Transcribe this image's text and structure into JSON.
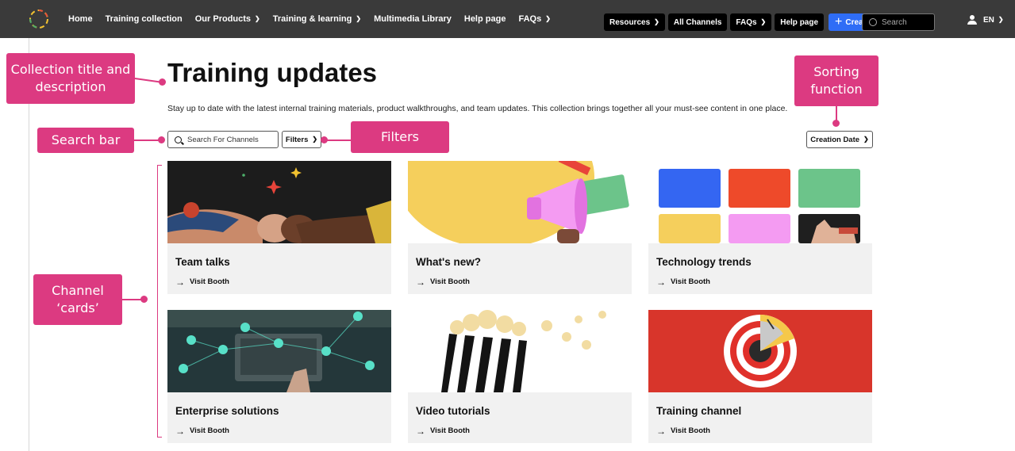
{
  "nav": {
    "left_items": [
      {
        "label": "Home",
        "dropdown": false
      },
      {
        "label": "Training collection",
        "dropdown": false
      },
      {
        "label": "Our Products",
        "dropdown": true
      },
      {
        "label": "Training & learning",
        "dropdown": true
      },
      {
        "label": "Multimedia Library",
        "dropdown": false
      },
      {
        "label": "Help page",
        "dropdown": false
      },
      {
        "label": "FAQs",
        "dropdown": true
      }
    ],
    "right_items": [
      {
        "label": "Resources",
        "dropdown": true
      },
      {
        "label": "All Channels",
        "dropdown": false
      },
      {
        "label": "FAQs",
        "dropdown": true
      },
      {
        "label": "Help page",
        "dropdown": false
      }
    ],
    "create_label": "Create",
    "search_placeholder": "Search",
    "language": "EN"
  },
  "collection": {
    "title": "Training updates",
    "description": "Stay up to date with the latest internal training materials, product walkthroughs, and team updates. This collection brings together all your must-see content in one place."
  },
  "controls": {
    "search_placeholder": "Search For Channels",
    "filters_label": "Filters",
    "sort_label": "Creation Date"
  },
  "cards": [
    {
      "title": "Team talks",
      "link": "Visit Booth"
    },
    {
      "title": "What's new?",
      "link": "Visit Booth"
    },
    {
      "title": "Technology trends",
      "link": "Visit Booth"
    },
    {
      "title": "Enterprise solutions",
      "link": "Visit Booth"
    },
    {
      "title": "Video tutorials",
      "link": "Visit Booth"
    },
    {
      "title": "Training channel",
      "link": "Visit Booth"
    }
  ],
  "callouts": {
    "title_desc": "Collection title and description",
    "search": "Search bar",
    "filters": "Filters",
    "sorting": "Sorting function",
    "cards": "Channel ‘cards’"
  },
  "colors": {
    "nav_bg": "#3a3a3a",
    "accent": "#2f6df6",
    "callout": "#dc3a81",
    "card_bg": "#f1f1f1"
  }
}
